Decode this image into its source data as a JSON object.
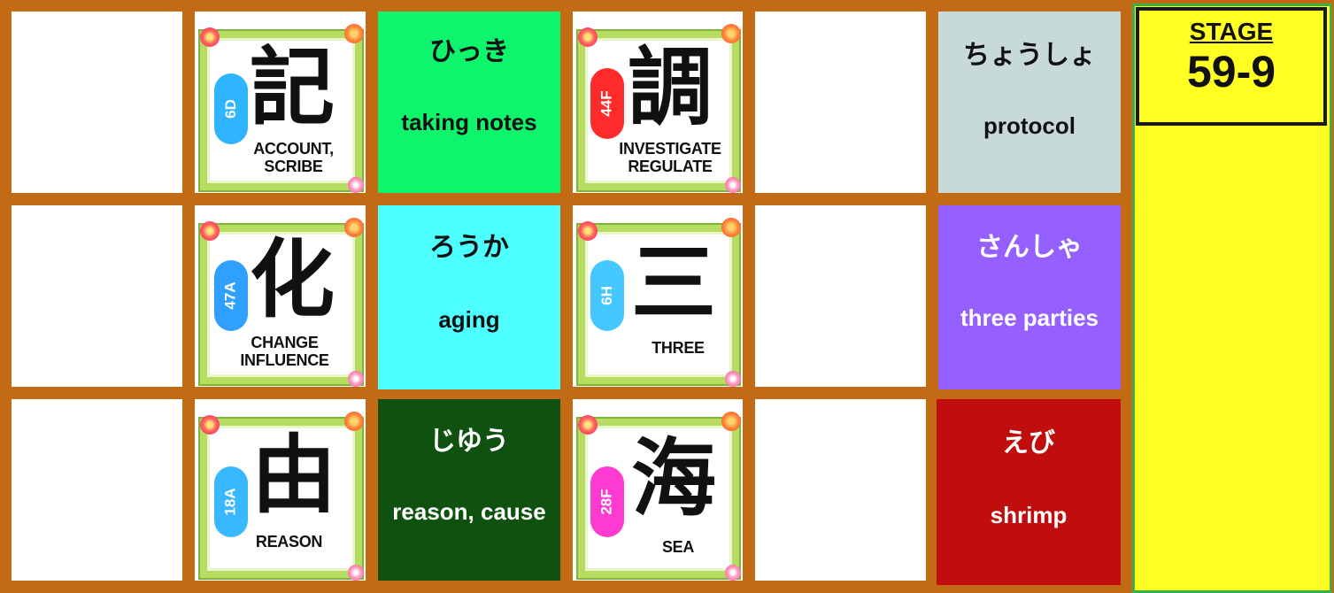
{
  "stage": {
    "label": "STAGE",
    "number": "59-9"
  },
  "kanji_cards": [
    {
      "kanji": "記",
      "code": "6D",
      "meaning": "ACCOUNT, SCRIBE",
      "badge_color": "#2fb4ff"
    },
    {
      "kanji": "調",
      "code": "44F",
      "meaning": "INVESTIGATE REGULATE",
      "badge_color": "#ff2a2a"
    },
    {
      "kanji": "化",
      "code": "47A",
      "meaning": "CHANGE INFLUENCE",
      "badge_color": "#2fa0ff"
    },
    {
      "kanji": "三",
      "code": "6H",
      "meaning": "THREE",
      "badge_color": "#44c8ff"
    },
    {
      "kanji": "由",
      "code": "18A",
      "meaning": "REASON",
      "badge_color": "#38b8ff"
    },
    {
      "kanji": "海",
      "code": "28F",
      "meaning": "SEA",
      "badge_color": "#ff3ad0"
    }
  ],
  "word_tiles": [
    {
      "reading": "ひっき",
      "gloss": "taking notes",
      "bg": "#0ef56d",
      "text_color": "#111111"
    },
    {
      "reading": "ちょうしょ",
      "gloss": "protocol",
      "bg": "#c7d9d9",
      "text_color": "#111111"
    },
    {
      "reading": "ろうか",
      "gloss": "aging",
      "bg": "#4dffff",
      "text_color": "#111111"
    },
    {
      "reading": "さんしゃ",
      "gloss": "three parties",
      "bg": "#9560ff",
      "text_color": "#ffffff"
    },
    {
      "reading": "じゆう",
      "gloss": "reason, cause",
      "bg": "#0f520f",
      "text_color": "#ffffff"
    },
    {
      "reading": "えび",
      "gloss": "shrimp",
      "bg": "#c00d0d",
      "text_color": "#ffffff"
    }
  ]
}
